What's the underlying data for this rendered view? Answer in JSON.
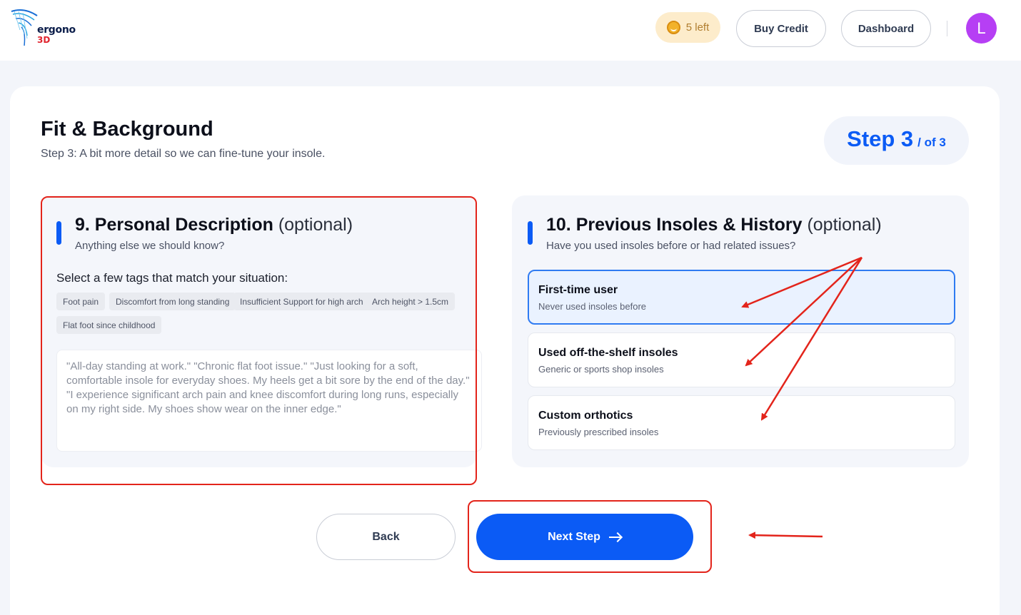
{
  "header": {
    "logo_word": "ergono",
    "logo_suffix": "3D",
    "credits_label": "5 left",
    "buy_credit_label": "Buy Credit",
    "dashboard_label": "Dashboard",
    "avatar_initial": "L"
  },
  "page": {
    "title": "Fit & Background",
    "subtitle": "Step 3: A bit more detail so we can fine-tune your insole.",
    "step_main": "Step 3",
    "step_total": "/ of 3"
  },
  "personal": {
    "title": "9. Personal Description",
    "optional": "(optional)",
    "subtitle": "Anything else we should know?",
    "tags_label": "Select a few tags that match your situation:",
    "tags": [
      "Foot pain",
      "Discomfort from long standing",
      "Insufficient Support for high arch",
      "Arch height > 1.5cm",
      "Flat foot since childhood"
    ],
    "placeholder": "\"All-day standing at work.\" \"Chronic flat foot issue.\" \"Just looking for a soft, comfortable insole for everyday shoes. My heels get a bit sore by the end of the day.\" \"I experience significant arch pain and knee discomfort during long runs, especially on my right side. My shoes show wear on the inner edge.\""
  },
  "history": {
    "title": "10. Previous Insoles & History",
    "optional": "(optional)",
    "subtitle": "Have you used insoles before or had related issues?",
    "options": [
      {
        "title": "First-time user",
        "subtitle": "Never used insoles before",
        "selected": true
      },
      {
        "title": "Used off-the-shelf insoles",
        "subtitle": "Generic or sports shop insoles",
        "selected": false
      },
      {
        "title": "Custom orthotics",
        "subtitle": "Previously prescribed insoles",
        "selected": false
      }
    ]
  },
  "nav": {
    "back_label": "Back",
    "next_label": "Next Step"
  },
  "colors": {
    "primary": "#0b5bf5",
    "annotation": "#e3241b",
    "avatar": "#b63ff4",
    "credits_bg": "#fdeccb"
  }
}
